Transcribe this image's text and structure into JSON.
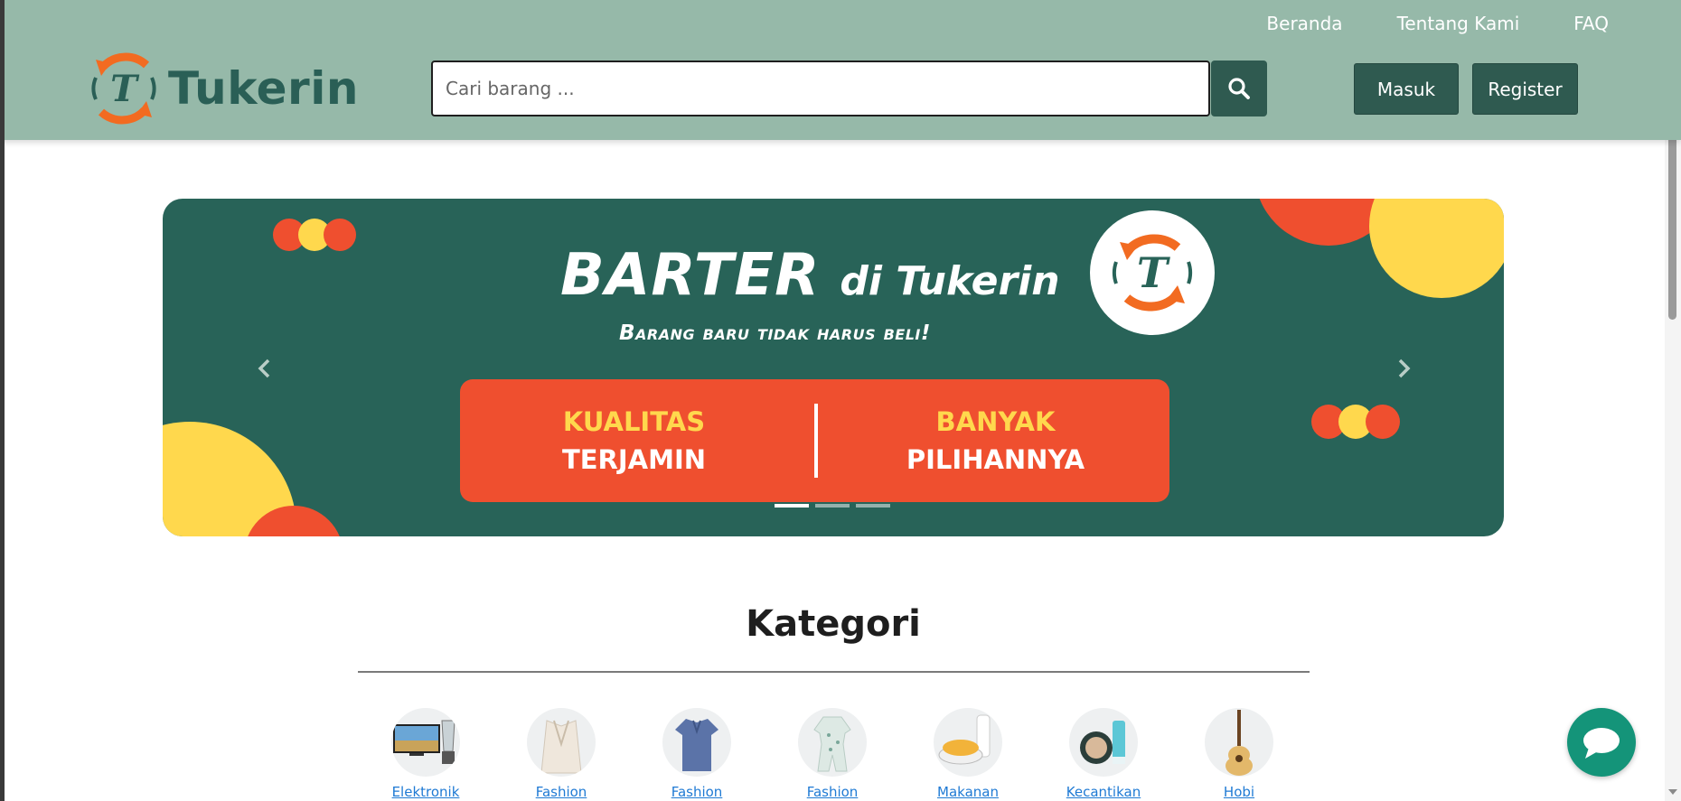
{
  "header": {
    "nav": [
      "Beranda",
      "Tentang Kami",
      "FAQ"
    ],
    "logo_text": "Tukerin",
    "search_placeholder": "Cari barang ...",
    "login_label": "Masuk",
    "register_label": "Register"
  },
  "banner": {
    "title_big": "BARTER",
    "title_small": "di Tukerin",
    "subtitle": "Barang baru tidak harus beli!",
    "left_top": "KUALITAS",
    "left_bottom": "TERJAMIN",
    "right_top": "BANYAK",
    "right_bottom": "PILIHANNYA",
    "slide_count": 3,
    "active_slide": 1
  },
  "categories": {
    "title": "Kategori",
    "items": [
      {
        "label": "Elektronik",
        "icon": "tv-blender-icon"
      },
      {
        "label": "Fashion",
        "icon": "blazer-icon"
      },
      {
        "label": "Fashion",
        "icon": "polo-shirt-icon"
      },
      {
        "label": "Fashion",
        "icon": "baby-onesie-icon"
      },
      {
        "label": "Makanan",
        "icon": "snack-milk-icon"
      },
      {
        "label": "Kecantikan",
        "icon": "cosmetics-icon"
      },
      {
        "label": "Hobi",
        "icon": "ukulele-icon"
      }
    ]
  },
  "colors": {
    "header_bg": "#96b9a9",
    "brand_dark": "#2f5a50",
    "banner_bg": "#286358",
    "orange": "#ef4f2f",
    "yellow": "#ffd84d",
    "chat": "#149479"
  }
}
